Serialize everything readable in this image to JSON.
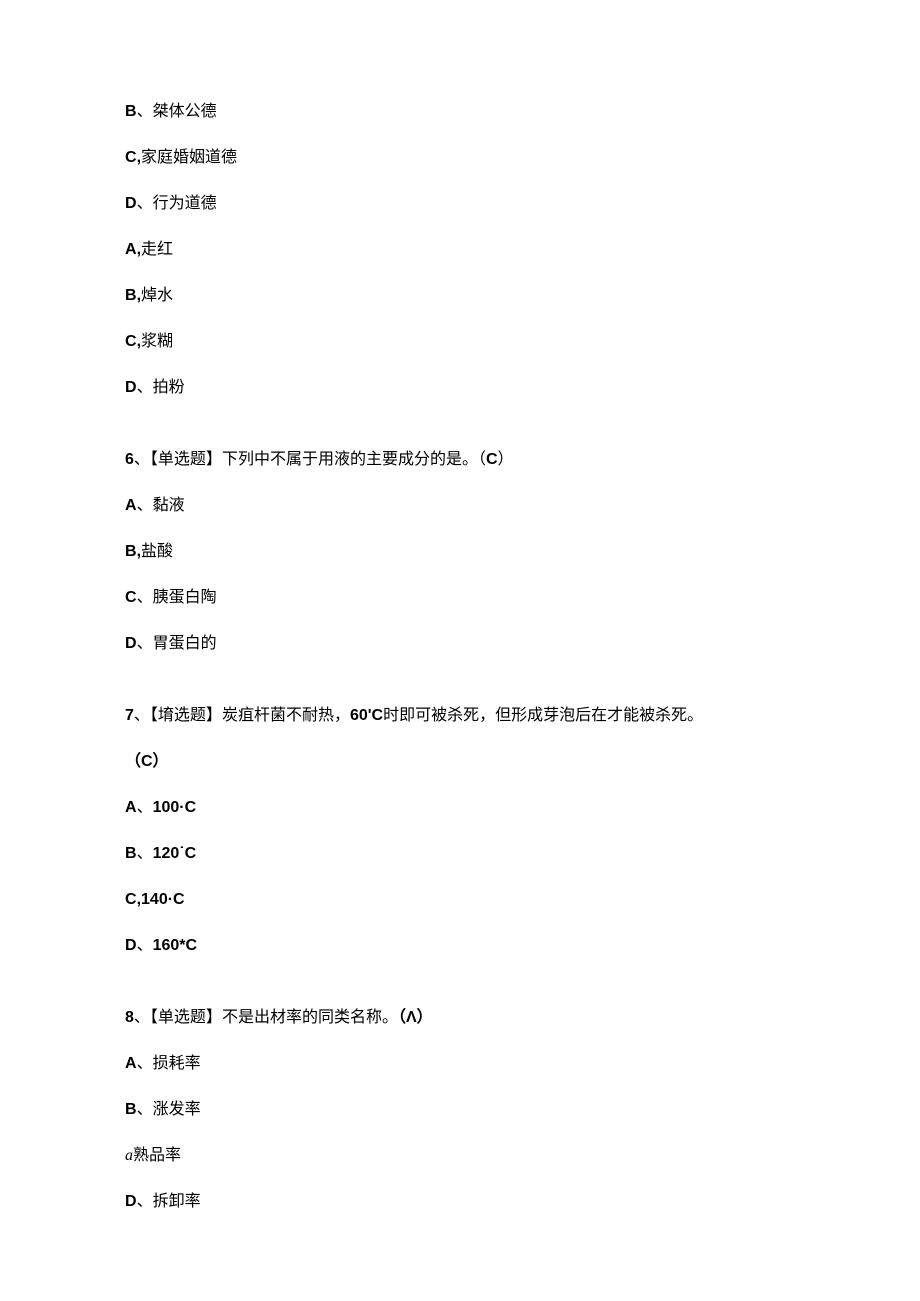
{
  "partial_options_top": [
    {
      "label": "B",
      "sep": "、",
      "text": "桀体公德"
    },
    {
      "label": "C",
      "sep": ",",
      "text": "家庭婚姻道德"
    },
    {
      "label": "D",
      "sep": "、",
      "text": "行为道德"
    },
    {
      "label": "A",
      "sep": ",",
      "text": "走红"
    },
    {
      "label": "B",
      "sep": ",",
      "text": "焯水"
    },
    {
      "label": "C",
      "sep": ",",
      "text": "浆糊"
    },
    {
      "label": "D",
      "sep": "、",
      "text": "拍粉"
    }
  ],
  "q6": {
    "number": "6",
    "tag": "【单选题】",
    "text": "下列中不属于用液的主要成分的是。",
    "answer": "（C）",
    "options": [
      {
        "label": "A",
        "sep": "、",
        "text": "黏液"
      },
      {
        "label": "B",
        "sep": ",",
        "text": "盐酸"
      },
      {
        "label": "C",
        "sep": "、",
        "text": "胰蛋白陶"
      },
      {
        "label": "D",
        "sep": "、",
        "text": "胃蛋白的"
      }
    ]
  },
  "q7": {
    "number": "7",
    "tag": "【堉选题】",
    "text_part1": "炭疽杆菌不耐热，",
    "text_bold_mid": "60'C",
    "text_part2": "时即可被杀死，但形成芽泡后在才能被杀死。",
    "answer": "（C）",
    "options": [
      {
        "label": "A",
        "sep": "、",
        "text": "100·C"
      },
      {
        "label": "B",
        "sep": "、",
        "text": "120˙C"
      },
      {
        "label": "C",
        "sep": ",",
        "text": "140·C"
      },
      {
        "label": "D",
        "sep": "、",
        "text": "160*C"
      }
    ]
  },
  "q8": {
    "number": "8",
    "tag": "【单选题】",
    "text": "不是出材率的同类名称。",
    "answer": "（Λ）",
    "options": [
      {
        "label": "A",
        "sep": "、",
        "text": "损耗率"
      },
      {
        "label": "B",
        "sep": "、",
        "text": "涨发率"
      },
      {
        "label_italic": "a",
        "text": "熟品率"
      },
      {
        "label": "D",
        "sep": "、",
        "text": "拆卸率"
      }
    ]
  }
}
